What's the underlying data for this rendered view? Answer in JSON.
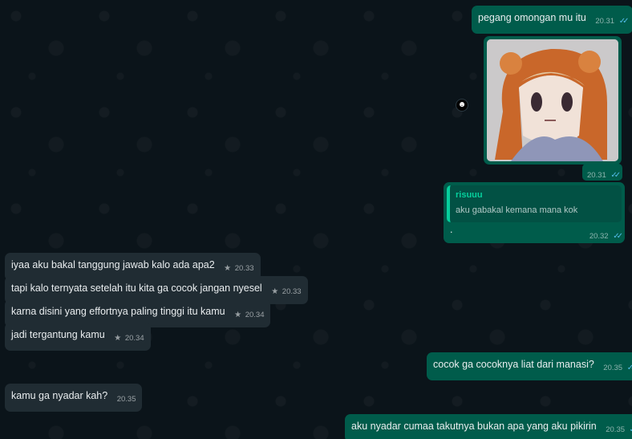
{
  "messages": {
    "m1": {
      "text": "pegang omongan mu itu",
      "time": "20.31",
      "ticks": "✓✓"
    },
    "image": {
      "time": "20.31",
      "ticks": "✓✓"
    },
    "reply": {
      "quote_name": "risuuu",
      "quote_text": "aku gabakal kemana mana kok",
      "text": ".",
      "time": "20.32",
      "ticks": "✓✓"
    },
    "in1": {
      "text": "iyaa aku bakal tanggung jawab kalo ada apa2",
      "time": "20.33",
      "star": "★"
    },
    "in2": {
      "text": "tapi kalo ternyata setelah itu kita ga cocok jangan nyesel",
      "time": "20.33",
      "star": "★"
    },
    "in3": {
      "text": "karna disini yang effortnya paling tinggi itu kamu",
      "time": "20.34",
      "star": "★"
    },
    "in4": {
      "text": "jadi tergantung kamu",
      "time": "20.34",
      "star": "★"
    },
    "out2": {
      "text": "cocok ga cocoknya liat dari manasi?",
      "time": "20.35",
      "ticks": "✓✓"
    },
    "in5": {
      "text": "kamu ga nyadar kah?",
      "time": "20.35"
    },
    "out3": {
      "text": "aku nyadar cumaa takutnya bukan apa yang aku pikirin",
      "time": "20.35",
      "ticks": "✓✓"
    }
  },
  "emoji_icon": "☻",
  "colors": {
    "background": "#0b141a",
    "outgoing": "#005c4b",
    "incoming": "#202c33",
    "tick_read": "#53bdeb",
    "quote_accent": "#06cf9c"
  }
}
